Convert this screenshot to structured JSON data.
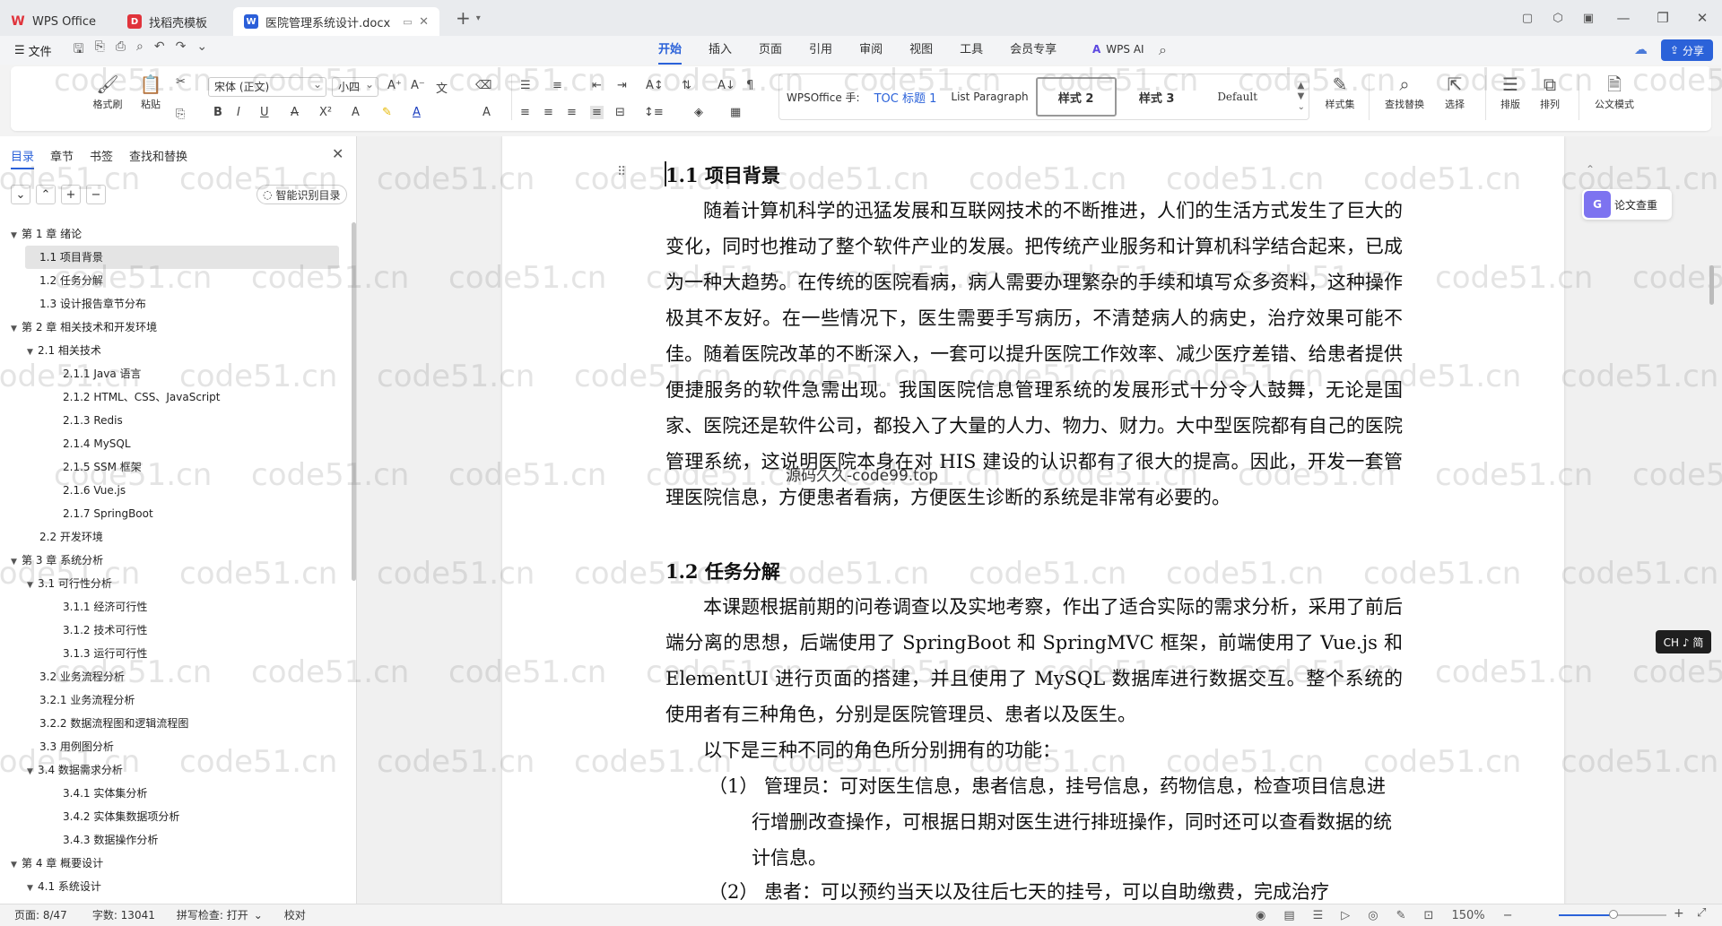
{
  "titlebar": {
    "tabs": [
      {
        "label": "WPS Office",
        "icon": "wps-logo-icon"
      },
      {
        "label": "找稻壳模板",
        "icon": "daoke-icon"
      },
      {
        "label": "医院管理系统设计.docx",
        "icon": "word-doc-icon"
      }
    ],
    "doc_icon_letter": "W",
    "tpl_icon_letter": "D"
  },
  "menubar": {
    "file_label": "文件",
    "ribbon_tabs": [
      "开始",
      "插入",
      "页面",
      "引用",
      "审阅",
      "视图",
      "工具",
      "会员专享"
    ],
    "active_tab": "开始",
    "wps_ai_label": "WPS AI",
    "share_label": "分享"
  },
  "ribbon": {
    "format_painter": "格式刷",
    "paste": "粘贴",
    "font_name": "宋体 (正文)",
    "font_size": "小四",
    "styles": [
      "WPSOffice 手:",
      "TOC 标题 1",
      "List Paragraph",
      "样式 2",
      "样式 3",
      "Default"
    ],
    "style_set": "样式集",
    "find_replace": "查找替换",
    "select": "选择",
    "layout": "排版",
    "arrange": "排列",
    "official_mode": "公文模式"
  },
  "nav": {
    "tabs": [
      "目录",
      "章节",
      "书签",
      "查找和替换"
    ],
    "smart_toc": "智能识别目录",
    "items": [
      {
        "label": "第 1 章  绪论",
        "level": 1,
        "arrow": "▼"
      },
      {
        "label": "1.1  项目背景",
        "level": 2,
        "active": true
      },
      {
        "label": "1.2  任务分解",
        "level": 2
      },
      {
        "label": "1.3  设计报告章节分布",
        "level": 2
      },
      {
        "label": "第 2 章  相关技术和开发环境",
        "level": 1,
        "arrow": "▼"
      },
      {
        "label": "2.1  相关技术",
        "level": 2,
        "arrow": "▼"
      },
      {
        "label": "2.1.1 Java 语言",
        "level": 3
      },
      {
        "label": "2.1.2 HTML、CSS、JavaScript",
        "level": 3
      },
      {
        "label": "2.1.3 Redis",
        "level": 3
      },
      {
        "label": "2.1.4 MySQL",
        "level": 3
      },
      {
        "label": "2.1.5 SSM 框架",
        "level": 3
      },
      {
        "label": "2.1.6 Vue.js",
        "level": 3
      },
      {
        "label": "2.1.7 SpringBoot",
        "level": 3
      },
      {
        "label": "2.2  开发环境",
        "level": 2
      },
      {
        "label": "第 3 章  系统分析",
        "level": 1,
        "arrow": "▼"
      },
      {
        "label": "3.1  可行性分析",
        "level": 2,
        "arrow": "▼"
      },
      {
        "label": "3.1.1  经济可行性",
        "level": 3
      },
      {
        "label": "3.1.2  技术可行性",
        "level": 3
      },
      {
        "label": "3.1.3  运行可行性",
        "level": 3
      },
      {
        "label": "3.2  业务流程分析",
        "level": 2
      },
      {
        "label": "3.2.1  业务流程分析",
        "level": 2
      },
      {
        "label": "3.2.2  数据流程图和逻辑流程图",
        "level": 2
      },
      {
        "label": "3.3  用例图分析",
        "level": 2
      },
      {
        "label": "3.4  数据需求分析",
        "level": 2,
        "arrow": "▼"
      },
      {
        "label": "3.4.1  实体集分析",
        "level": 3
      },
      {
        "label": "3.4.2  实体集数据项分析",
        "level": 3
      },
      {
        "label": "3.4.3  数据操作分析",
        "level": 3
      },
      {
        "label": "第 4 章  概要设计",
        "level": 1,
        "arrow": "▼"
      },
      {
        "label": "4.1  系统设计",
        "level": 2,
        "arrow": "▼"
      }
    ]
  },
  "doc": {
    "h1": "1.1 项目背景",
    "p1": "随着计算机科学的迅猛发展和互联网技术的不断推进，人们的生活方式发生了巨大的变化，同时也推动了整个软件产业的发展。把传统产业服务和计算机科学结合起来，已成为一种大趋势。在传统的医院看病，病人需要办理繁杂的手续和填写众多资料，这种操作极其不友好。在一些情况下，医生需要手写病历，不清楚病人的病史，治疗效果可能不佳。随着医院改革的不断深入，一套可以提升医院工作效率、减少医疗差错、给患者提供便捷服务的软件急需出现。我国医院信息管理系统的发展形式十分令人鼓舞，无论是国家、医院还是软件公司，都投入了大量的人力、物力、财力。大中型医院都有自己的医院管理系统，这说明医院本身在对 HIS 建设的认识都有了很大的提高。因此，开发一套管理医院信息，方便患者看病，方便医生诊断的系统是非常有必要的。",
    "h2": "1.2 任务分解",
    "p2": "本课题根据前期的问卷调查以及实地考察，作出了适合实际的需求分析，采用了前后端分离的思想，后端使用了 SpringBoot 和 SpringMVC 框架，前端使用了 Vue.js 和 ElementUI 进行页面的搭建，并且使用了 MySQL 数据库进行数据交互。整个系统的使用者有三种角色，分别是医院管理员、患者以及医生。",
    "p3": "以下是三种不同的角色所分别拥有的功能：",
    "li1": "（1）  管理员：可对医生信息，患者信息，挂号信息，药物信息，检查项目信息进行增删改查操作，可根据日期对医生进行排班操作，同时还可以查看数据的统计信息。",
    "li2": "（2）  患者：可以预约当天以及往后七天的挂号，可以自助缴费，完成治疗",
    "overlay_text": "源码久久-code99.top",
    "essay_check": "论文查重",
    "ime": "CH ♪ 简",
    "watermark": "code51.cn"
  },
  "status": {
    "page": "页面: 8/47",
    "words": "字数: 13041",
    "spell": "拼写检查: 打开",
    "proof": "校对",
    "zoom": "150%"
  }
}
